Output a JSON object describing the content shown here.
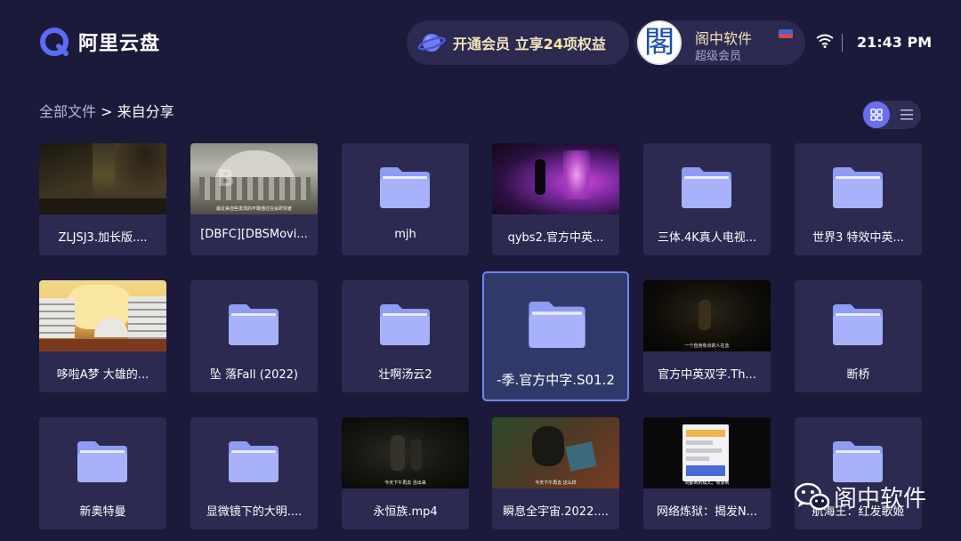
{
  "header": {
    "app_name": "阿里云盘",
    "vip_promo": {
      "prefix": "开通会员 立享",
      "count": "24",
      "suffix": "项权益"
    },
    "user": {
      "avatar_glyph": "閣",
      "name": "阁中软件",
      "level": "超级会员"
    },
    "clock": "21:43 PM",
    "icons": [
      "planet-icon",
      "wifi-icon"
    ]
  },
  "breadcrumb": {
    "root": "全部文件",
    "separator": " > ",
    "current": "来自分享"
  },
  "view_toggle": {
    "active": "grid",
    "icons": [
      "grid-view-icon",
      "list-view-icon"
    ]
  },
  "files": [
    {
      "name": "ZLJSJ3.加长版....",
      "type": "video"
    },
    {
      "name": "[DBFC][DBSMovi...",
      "type": "video"
    },
    {
      "name": "mjh",
      "type": "folder"
    },
    {
      "name": "qybs2.官方中英...",
      "type": "video"
    },
    {
      "name": "三体.4K真人电视...",
      "type": "folder"
    },
    {
      "name": "世界3 特效中英...",
      "type": "folder"
    },
    {
      "name": "哆啦A梦 大雄的...",
      "type": "video"
    },
    {
      "name": "坠 落Fall (2022)",
      "type": "folder"
    },
    {
      "name": "壮啊汤云2",
      "type": "folder"
    },
    {
      "name": "-季.官方中字.S01.2",
      "type": "folder",
      "focused": true
    },
    {
      "name": "官方中英双字.Th...",
      "type": "video"
    },
    {
      "name": "断桥",
      "type": "folder"
    },
    {
      "name": "新奥特曼",
      "type": "folder"
    },
    {
      "name": "显微镜下的大明....",
      "type": "folder"
    },
    {
      "name": "永恒族.mp4",
      "type": "video"
    },
    {
      "name": "瞬息全宇宙.2022....",
      "type": "video"
    },
    {
      "name": "网络炼狱：揭发N...",
      "type": "video"
    },
    {
      "name": "航海王：红发歌姬",
      "type": "folder"
    }
  ],
  "thumb_subtitles": {
    "dbfc": "最近来自些发现的不敢通过在会研究者",
    "officer": "一个自身有点的人在去",
    "eternals": "今天下午再去 活出来",
    "everything": "今天下午再去 这么样",
    "netherworld": "向都到的模式，收录到"
  },
  "watermark": {
    "text": "阁中软件",
    "icon": "wechat-icon"
  },
  "colors": {
    "background": "#1c1a3a",
    "card": "#2c2a50",
    "accent": "#6b6ef0",
    "focus_border": "#6d86ff",
    "gold_text": "#f1e4b8"
  }
}
